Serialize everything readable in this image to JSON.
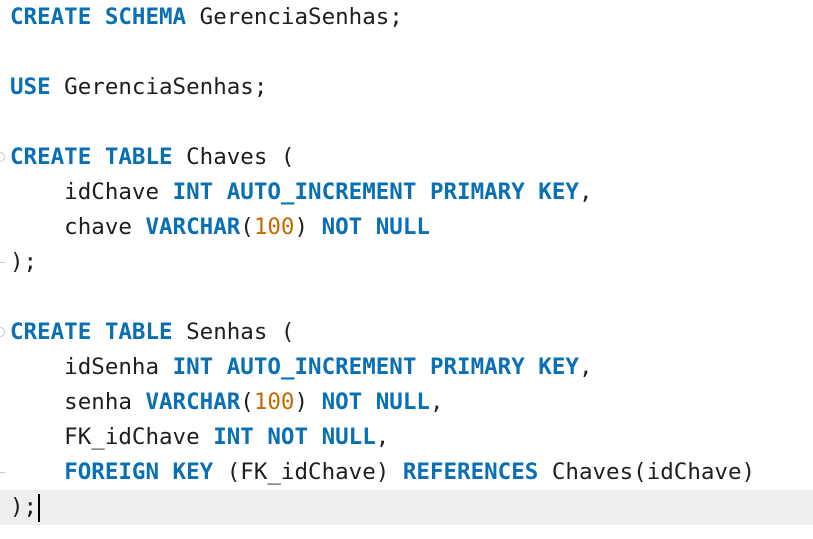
{
  "editor": {
    "lines": [
      [
        {
          "t": "CREATE SCHEMA",
          "k": "kw"
        },
        {
          "t": " GerenciaSenhas;",
          "k": "id"
        }
      ],
      [],
      [
        {
          "t": "USE",
          "k": "kw"
        },
        {
          "t": " GerenciaSenhas;",
          "k": "id"
        }
      ],
      [],
      [
        {
          "t": "CREATE TABLE",
          "k": "kw"
        },
        {
          "t": " Chaves (",
          "k": "id"
        }
      ],
      [
        {
          "t": "    idChave ",
          "k": "id"
        },
        {
          "t": "INT AUTO_INCREMENT PRIMARY KEY",
          "k": "kw"
        },
        {
          "t": ",",
          "k": "id"
        }
      ],
      [
        {
          "t": "    chave ",
          "k": "id"
        },
        {
          "t": "VARCHAR",
          "k": "kw"
        },
        {
          "t": "(",
          "k": "id"
        },
        {
          "t": "100",
          "k": "num"
        },
        {
          "t": ") ",
          "k": "id"
        },
        {
          "t": "NOT NULL",
          "k": "kw"
        }
      ],
      [
        {
          "t": ");",
          "k": "id"
        }
      ],
      [],
      [
        {
          "t": "CREATE TABLE",
          "k": "kw"
        },
        {
          "t": " Senhas (",
          "k": "id"
        }
      ],
      [
        {
          "t": "    idSenha ",
          "k": "id"
        },
        {
          "t": "INT AUTO_INCREMENT PRIMARY KEY",
          "k": "kw"
        },
        {
          "t": ",",
          "k": "id"
        }
      ],
      [
        {
          "t": "    senha ",
          "k": "id"
        },
        {
          "t": "VARCHAR",
          "k": "kw"
        },
        {
          "t": "(",
          "k": "id"
        },
        {
          "t": "100",
          "k": "num"
        },
        {
          "t": ") ",
          "k": "id"
        },
        {
          "t": "NOT NULL",
          "k": "kw"
        },
        {
          "t": ",",
          "k": "id"
        }
      ],
      [
        {
          "t": "    FK_idChave ",
          "k": "id"
        },
        {
          "t": "INT NOT NULL",
          "k": "kw"
        },
        {
          "t": ",",
          "k": "id"
        }
      ],
      [
        {
          "t": "    ",
          "k": "id"
        },
        {
          "t": "FOREIGN KEY",
          "k": "kw"
        },
        {
          "t": " (FK_idChave) ",
          "k": "id"
        },
        {
          "t": "REFERENCES",
          "k": "kw"
        },
        {
          "t": " Chaves(idChave)",
          "k": "id"
        }
      ],
      [
        {
          "t": ");",
          "k": "id"
        }
      ]
    ],
    "current_line": 14,
    "fold_starts": [
      4,
      9
    ],
    "fold_ends": [
      7,
      13
    ]
  }
}
